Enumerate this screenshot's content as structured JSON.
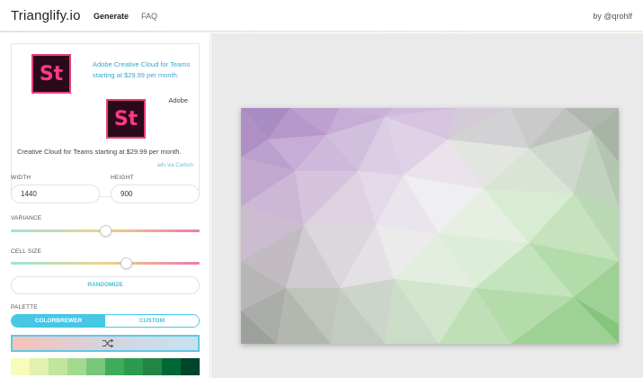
{
  "header": {
    "brand": "Trianglify.io",
    "nav": [
      {
        "label": "Generate"
      },
      {
        "label": "FAQ"
      }
    ],
    "byline": "by @qrohlf"
  },
  "ad": {
    "logo_text": "St",
    "link_text": "Adobe Creative Cloud for Teams starting at $29.99 per month.",
    "brand": "Adobe",
    "description": "Creative Cloud for Teams starting at $29.99 per month.",
    "via": "ads via Carbon"
  },
  "size": {
    "width_label": "WIDTH",
    "width_value": "1440",
    "height_label": "HEIGHT",
    "height_value": "900"
  },
  "variance": {
    "label": "VARIANCE",
    "value": 0.5
  },
  "cell_size": {
    "label": "CELL SIZE",
    "value": 0.61
  },
  "randomize_label": "RANDOMIZE",
  "palette": {
    "label": "PALETTE",
    "tabs": [
      {
        "label": "COLORBREWER"
      },
      {
        "label": "CUSTOM"
      }
    ],
    "active_tab": 0,
    "swatches": [
      "#f7fcb9",
      "#e2f0b0",
      "#c2e59c",
      "#a3d98f",
      "#78c679",
      "#41ab5d",
      "#2c9a4f",
      "#238443",
      "#006837",
      "#004529"
    ]
  },
  "colors": {
    "accent": "#46c7e6",
    "link": "#3aa7cf",
    "adobe_pink": "#ff3a84"
  }
}
